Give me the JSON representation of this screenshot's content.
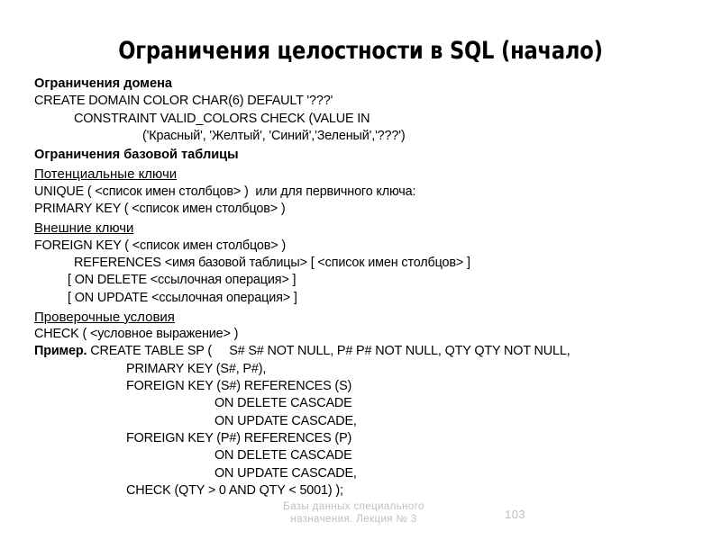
{
  "slide": {
    "title": "Ограничения целостности в SQL (начало)",
    "background_color": "#ffffff",
    "text_color": "#000000",
    "footer_color": "#bfbfbf"
  },
  "sections": {
    "domain_constraints": {
      "heading": "Ограничения домена",
      "lines": [
        "CREATE DOMAIN COLOR CHAR(6) DEFAULT '???'",
        "CONSTRAINT VALID_COLORS CHECK (VALUE IN",
        "('Красный', 'Желтый', 'Синий','Зеленый','???')"
      ]
    },
    "base_table_constraints": {
      "heading": "Ограничения базовой таблицы"
    },
    "candidate_keys": {
      "heading": "Потенциальные ключи",
      "lines": [
        "UNIQUE ( <список имен столбцов> )  или для первичного ключа:",
        "PRIMARY KEY ( <список имен столбцов> )"
      ]
    },
    "foreign_keys": {
      "heading": "Внешние ключи",
      "lines": [
        "FOREIGN KEY ( <список имен столбцов> )",
        "REFERENCES <имя базовой таблицы> [ <список имен столбцов> ]",
        "[ ON DELETE <ссылочная операция> ]",
        "[ ON UPDATE <ссылочная операция> ]"
      ]
    },
    "check_conditions": {
      "heading": "Проверочные условия",
      "lines": [
        "CHECK ( <условное выражение> )"
      ]
    },
    "example": {
      "label": "Пример.",
      "first_line": " CREATE TABLE SP (     S# S# NOT NULL, P# P# NOT NULL, QTY QTY NOT NULL,",
      "lines": [
        "PRIMARY KEY (S#, P#),",
        "FOREIGN KEY (S#) REFERENCES (S)",
        "ON DELETE CASCADE",
        "ON UPDATE CASCADE,",
        "FOREIGN KEY (P#) REFERENCES (P)",
        "ON DELETE CASCADE",
        "ON UPDATE CASCADE,",
        "CHECK (QTY > 0 AND QTY < 5001) );"
      ]
    }
  },
  "footer": {
    "text": "Базы данных специального назначения. Лекция № 3",
    "page_number": "103"
  }
}
